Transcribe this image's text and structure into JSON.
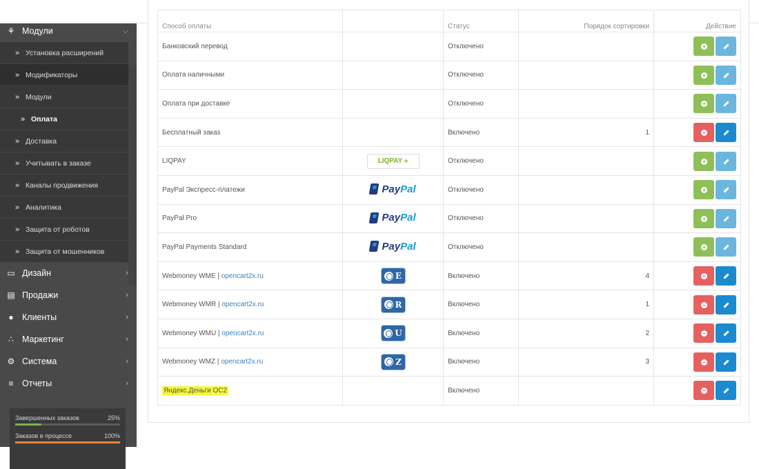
{
  "sidebar": {
    "sections": [
      {
        "id": "modules",
        "label": "Модули",
        "icon": "puzzle-icon"
      },
      {
        "id": "design",
        "label": "Дизайн",
        "icon": "monitor-icon"
      },
      {
        "id": "sales",
        "label": "Продажи",
        "icon": "cart-icon"
      },
      {
        "id": "clients",
        "label": "Клиенты",
        "icon": "user-icon"
      },
      {
        "id": "marketing",
        "label": "Маркетинг",
        "icon": "share-icon"
      },
      {
        "id": "system",
        "label": "Система",
        "icon": "gear-icon"
      },
      {
        "id": "reports",
        "label": "Отчеты",
        "icon": "bar-chart-icon"
      }
    ],
    "submenu": [
      {
        "label": "Установка расширений"
      },
      {
        "label": "Модификаторы"
      },
      {
        "label": "Модули"
      },
      {
        "label": "Оплата",
        "active": true
      },
      {
        "label": "Доставка"
      },
      {
        "label": "Учитывать в заказе"
      },
      {
        "label": "Каналы продвижения"
      },
      {
        "label": "Аналитика"
      },
      {
        "label": "Защита от роботов"
      },
      {
        "label": "Защита от мошенников"
      }
    ],
    "stats": [
      {
        "label": "Завершенных заказов",
        "value": "25%",
        "fraction": 0.25,
        "color": "#7ab648"
      },
      {
        "label": "Заказов в процессе",
        "value": "100%",
        "fraction": 1.0,
        "color": "#e8833a"
      }
    ]
  },
  "table": {
    "headers": [
      "Способ оплаты",
      "",
      "Статус",
      "Порядок сортировки",
      "Действие"
    ],
    "rows": [
      {
        "name": "Банковский перевод",
        "logo": "",
        "status": "Отключено",
        "sort": "",
        "enabled": false
      },
      {
        "name": "Оплата наличными",
        "logo": "",
        "status": "Отключено",
        "sort": "",
        "enabled": false
      },
      {
        "name": "Оплата при доставке",
        "logo": "",
        "status": "Отключено",
        "sort": "",
        "enabled": false
      },
      {
        "name": "Бесплатный заказ",
        "logo": "",
        "status": "Включено",
        "sort": "1",
        "enabled": true
      },
      {
        "name": "LIQPAY",
        "logo": "liqpay",
        "logo_text": "LIQPAY",
        "status": "Отключено",
        "sort": "",
        "enabled": false
      },
      {
        "name": "PayPal Экспресс-платежи",
        "logo": "paypal",
        "status": "Отключено",
        "sort": "",
        "enabled": false
      },
      {
        "name": "PayPal Pro",
        "logo": "paypal",
        "status": "Отключено",
        "sort": "",
        "enabled": false
      },
      {
        "name": "PayPal Payments Standard",
        "logo": "paypal",
        "status": "Отключено",
        "sort": "",
        "enabled": false
      },
      {
        "name": "Webmoney WME",
        "link": "opencart2x.ru",
        "logo": "webmoney",
        "wm_letter": "E",
        "status": "Включено",
        "sort": "4",
        "enabled": true
      },
      {
        "name": "Webmoney WMR",
        "link": "opencart2x.ru",
        "logo": "webmoney",
        "wm_letter": "R",
        "status": "Включено",
        "sort": "1",
        "enabled": true
      },
      {
        "name": "Webmoney WMU",
        "link": "opencart2x.ru",
        "logo": "webmoney",
        "wm_letter": "U",
        "status": "Включено",
        "sort": "2",
        "enabled": true
      },
      {
        "name": "Webmoney WMZ",
        "link": "opencart2x.ru",
        "logo": "webmoney",
        "wm_letter": "Z",
        "status": "Включено",
        "sort": "3",
        "enabled": true
      },
      {
        "name": "Яндекс.Деньги OC2",
        "logo": "",
        "status": "Включено",
        "sort": "",
        "enabled": true,
        "highlight": true
      }
    ]
  },
  "colors": {
    "install": "#8fbf58",
    "edit_disabled": "#6ab6df",
    "uninstall": "#e56160",
    "edit": "#1c8ad0",
    "highlight": "#f4f93a"
  }
}
